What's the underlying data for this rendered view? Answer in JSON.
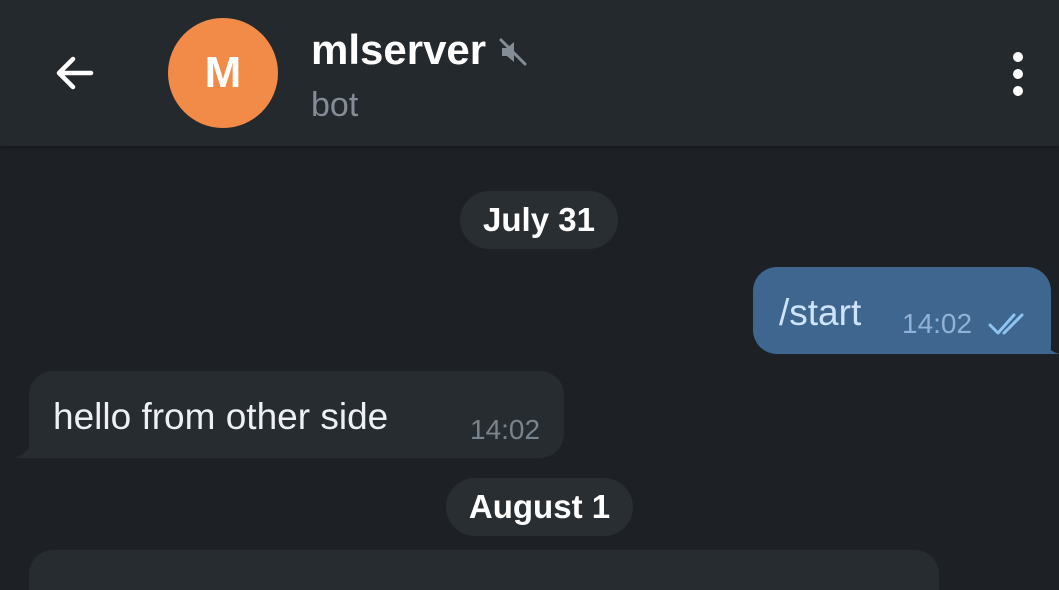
{
  "header": {
    "avatar_letter": "M",
    "avatar_color": "#f28b48",
    "title": "mlserver",
    "subtitle": "bot",
    "icons": [
      "back-arrow-icon",
      "muted-speaker-icon",
      "more-vertical-icon"
    ]
  },
  "messages": [
    {
      "type": "date",
      "label": "July 31"
    },
    {
      "type": "outgoing",
      "text": "/start",
      "time": "14:02",
      "status_icon": "double-check-icon"
    },
    {
      "type": "incoming",
      "text": "hello from other side",
      "time": "14:02"
    },
    {
      "type": "date",
      "label": "August 1"
    }
  ],
  "colors": {
    "background": "#1d2125",
    "header": "#24292d",
    "outgoing_bubble": "#3f668f",
    "incoming_bubble": "#272c31"
  }
}
